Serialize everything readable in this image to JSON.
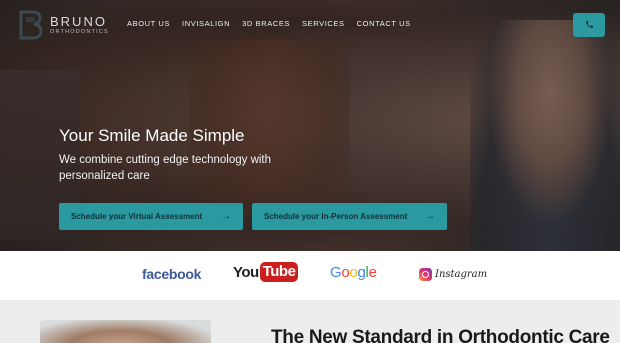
{
  "brand": {
    "name": "BRUNO",
    "subtitle": "ORTHODONTICS"
  },
  "nav": {
    "links": [
      "ABOUT US",
      "INVISALIGN",
      "3D BRACES",
      "SERVICES",
      "CONTACT US"
    ]
  },
  "hero": {
    "headline": "Your Smile Made Simple",
    "subline": "We combine cutting edge technology with personalized care",
    "cta_virtual": "Schedule your Virtual Assessment",
    "cta_in_person": "Schedule your In-Person Assessment"
  },
  "social": {
    "facebook": "facebook",
    "youtube_you": "You",
    "youtube_tube": "Tube",
    "google": [
      "G",
      "o",
      "o",
      "g",
      "l",
      "e"
    ],
    "instagram": "Instagram"
  },
  "section": {
    "title": "The New Standard in Orthodontic Care"
  },
  "colors": {
    "accent": "#2a9aa0",
    "facebook": "#3b5998",
    "youtube": "#cc1f1f",
    "google": [
      "#4285f4",
      "#ea4335",
      "#fbbc05",
      "#4285f4",
      "#34a853",
      "#ea4335"
    ]
  },
  "icons": {
    "phone": "phone-icon",
    "arrow": "arrow-right-icon",
    "logo": "bruno-logo-icon"
  }
}
